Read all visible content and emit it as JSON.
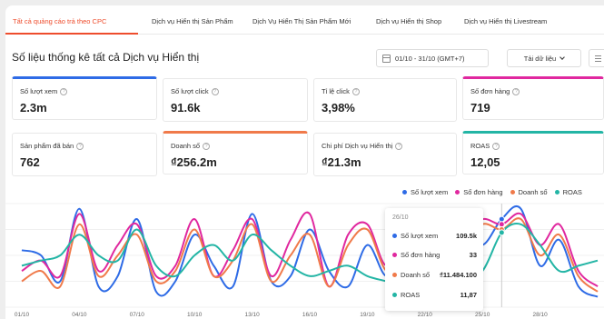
{
  "tabs": [
    {
      "label": "Tất cả quảng cáo trả theo CPC",
      "active": true
    },
    {
      "label": "Dịch vụ Hiển thị Sản Phẩm",
      "active": false
    },
    {
      "label": "Dịch Vụ Hiển Thị Sản Phẩm Mới",
      "active": false
    },
    {
      "label": "Dịch vụ Hiển thị Shop",
      "active": false
    },
    {
      "label": "Dịch vụ Hiển thị Livestream",
      "active": false
    }
  ],
  "header": {
    "title": "Số liệu thống kê tất cả Dịch vụ Hiển thị",
    "date_range": "01/10 - 31/10 (GMT+7)",
    "download_label": "Tải dữ liệu"
  },
  "metrics": [
    {
      "label": "Số lượt xem",
      "value": "2.3m",
      "selected": true,
      "color": "#2e6be6"
    },
    {
      "label": "Số lượt click",
      "value": "91.6k",
      "selected": false
    },
    {
      "label": "Tỉ lệ click",
      "value": "3,98%",
      "selected": false
    },
    {
      "label": "Số đơn hàng",
      "value": "719",
      "selected": true,
      "color": "#e0289f"
    },
    {
      "label": "Sản phẩm đã bán",
      "value": "762",
      "selected": false
    },
    {
      "label": "Doanh số",
      "value": "₫256.2m",
      "selected": true,
      "color": "#f07a4a"
    },
    {
      "label": "Chi phí Dịch vụ Hiển thị",
      "value": "₫21.3m",
      "selected": false
    },
    {
      "label": "ROAS",
      "value": "12,05",
      "selected": true,
      "color": "#23b5a5"
    }
  ],
  "tooltip": {
    "date": "26/10",
    "rows": [
      {
        "name": "Số lượt xem",
        "value": "109.5k",
        "color": "#2e6be6"
      },
      {
        "name": "Số đơn hàng",
        "value": "33",
        "color": "#e0289f"
      },
      {
        "name": "Doanh số",
        "value": "₫11.484.100",
        "color": "#f07a4a"
      },
      {
        "name": "ROAS",
        "value": "11,87",
        "color": "#23b5a5"
      }
    ]
  },
  "chart_data": {
    "type": "line",
    "x": [
      "01/10",
      "02/10",
      "03/10",
      "04/10",
      "05/10",
      "06/10",
      "07/10",
      "08/10",
      "09/10",
      "10/10",
      "11/10",
      "12/10",
      "13/10",
      "14/10",
      "15/10",
      "16/10",
      "17/10",
      "18/10",
      "19/10",
      "20/10",
      "21/10",
      "22/10",
      "23/10",
      "24/10",
      "25/10",
      "26/10",
      "27/10",
      "28/10",
      "29/10",
      "30/10",
      "31/10"
    ],
    "x_tick_labels": [
      "01/10",
      "04/10",
      "07/10",
      "10/10",
      "13/10",
      "16/10",
      "19/10",
      "22/10",
      "25/10",
      "28/10"
    ],
    "legend_position": "top-right",
    "series": [
      {
        "name": "Số lượt xem",
        "color": "#2e6be6",
        "values": [
          0.55,
          0.5,
          0.25,
          0.95,
          0.2,
          0.3,
          0.85,
          0.15,
          0.25,
          0.7,
          0.4,
          0.2,
          0.9,
          0.25,
          0.3,
          0.75,
          0.35,
          0.2,
          0.6,
          0.3,
          0.55,
          0.4,
          0.3,
          0.75,
          0.6,
          0.85,
          0.95,
          0.4,
          0.65,
          0.2,
          0.1
        ]
      },
      {
        "name": "Số đơn hàng",
        "color": "#e0289f",
        "values": [
          0.35,
          0.45,
          0.3,
          0.9,
          0.35,
          0.6,
          0.8,
          0.3,
          0.4,
          0.85,
          0.3,
          0.55,
          0.85,
          0.3,
          0.65,
          0.9,
          0.2,
          0.7,
          0.8,
          0.4,
          0.75,
          0.45,
          0.5,
          0.7,
          0.85,
          0.8,
          0.9,
          0.6,
          0.8,
          0.35,
          0.2
        ]
      },
      {
        "name": "Doanh số",
        "color": "#f07a4a",
        "values": [
          0.25,
          0.35,
          0.2,
          0.8,
          0.3,
          0.5,
          0.7,
          0.25,
          0.35,
          0.75,
          0.3,
          0.45,
          0.8,
          0.25,
          0.5,
          0.7,
          0.2,
          0.6,
          0.75,
          0.35,
          0.5,
          0.45,
          0.4,
          0.6,
          0.8,
          0.75,
          0.85,
          0.5,
          0.7,
          0.3,
          0.15
        ]
      },
      {
        "name": "ROAS",
        "color": "#23b5a5",
        "values": [
          0.4,
          0.45,
          0.5,
          0.7,
          0.5,
          0.45,
          0.75,
          0.4,
          0.3,
          0.5,
          0.6,
          0.45,
          0.7,
          0.55,
          0.4,
          0.3,
          0.35,
          0.4,
          0.3,
          0.25,
          0.2,
          0.3,
          0.25,
          0.3,
          0.35,
          0.72,
          0.8,
          0.6,
          0.35,
          0.4,
          0.45
        ]
      }
    ]
  }
}
